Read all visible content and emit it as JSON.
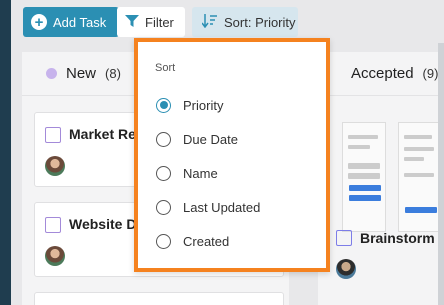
{
  "toolbar": {
    "add_task_label": "Add Task",
    "filter_label": "Filter",
    "sort_label": "Sort: Priority"
  },
  "columns": [
    {
      "name": "New",
      "count": "(8)",
      "cards": [
        {
          "title": "Market Re"
        },
        {
          "title": "Website Da"
        }
      ]
    },
    {
      "name": "Accepted",
      "count": "(9)",
      "cards": [
        {
          "title": "Brainstorm"
        }
      ]
    }
  ],
  "sort_menu": {
    "heading": "Sort",
    "options": [
      {
        "label": "Priority",
        "selected": true
      },
      {
        "label": "Due Date",
        "selected": false
      },
      {
        "label": "Name",
        "selected": false
      },
      {
        "label": "Last Updated",
        "selected": false
      },
      {
        "label": "Created",
        "selected": false
      }
    ]
  },
  "colors": {
    "primary": "#2b8fb3",
    "highlight_border": "#f5821f",
    "new_dot": "#c7b3ec",
    "accepted_dot": "#7d7de8"
  }
}
